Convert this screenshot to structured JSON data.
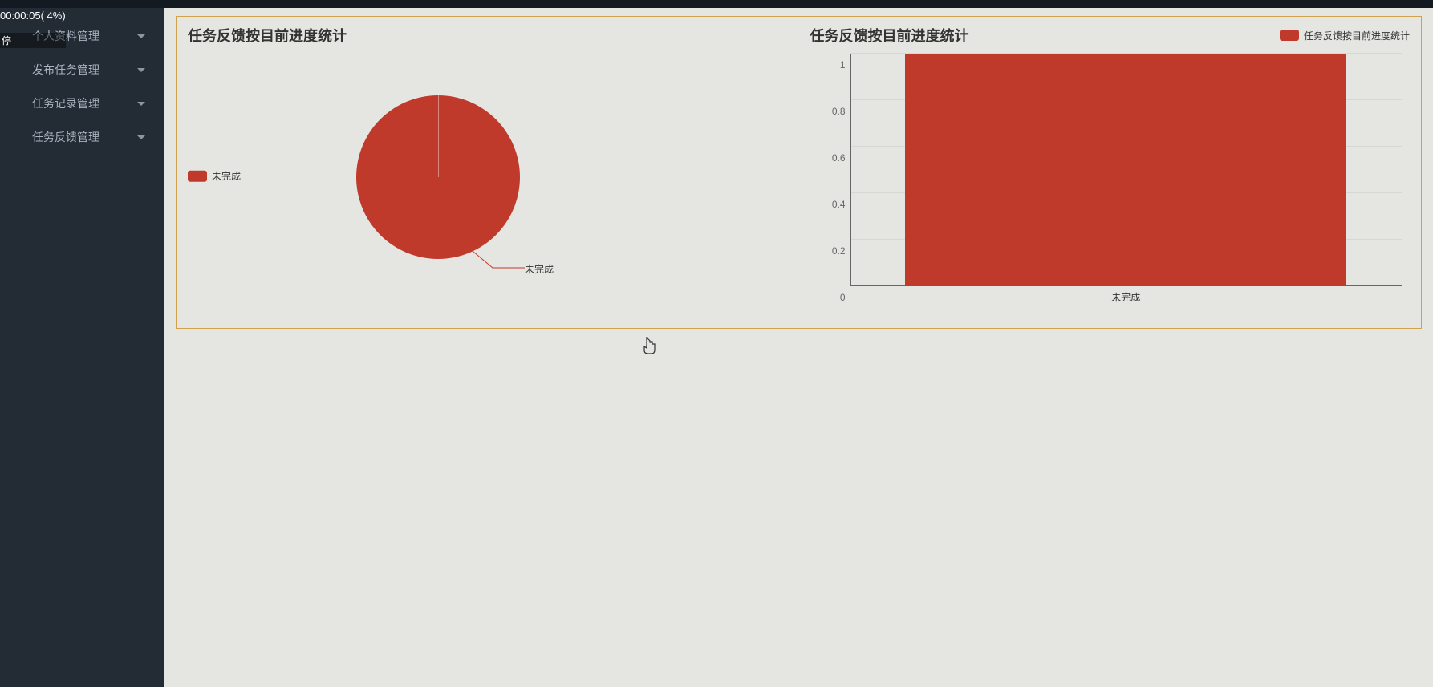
{
  "video_overlay": {
    "time_text": "00:00:05( 4%)",
    "pause_label": "停"
  },
  "sidebar": {
    "items": [
      {
        "label": "个人资料管理"
      },
      {
        "label": "发布任务管理"
      },
      {
        "label": "任务记录管理"
      },
      {
        "label": "任务反馈管理"
      }
    ]
  },
  "charts": {
    "pie": {
      "title": "任务反馈按目前进度统计",
      "legend_label": "未完成",
      "slice_label": "未完成"
    },
    "bar": {
      "title": "任务反馈按目前进度统计",
      "legend_label": "任务反馈按目前进度统计",
      "category_label": "未完成",
      "yticks": [
        "0",
        "0.2",
        "0.4",
        "0.6",
        "0.8",
        "1"
      ]
    }
  },
  "chart_data": [
    {
      "type": "pie",
      "title": "任务反馈按目前进度统计",
      "series": [
        {
          "name": "未完成",
          "value": 1
        }
      ]
    },
    {
      "type": "bar",
      "title": "任务反馈按目前进度统计",
      "categories": [
        "未完成"
      ],
      "values": [
        1
      ],
      "ylim": [
        0,
        1
      ],
      "xlabel": "",
      "ylabel": ""
    }
  ],
  "colors": {
    "accent": "#c03a2b",
    "panel_border": "#d2a24a",
    "sidebar_bg": "#232c35",
    "content_bg": "#e5e5e2"
  }
}
